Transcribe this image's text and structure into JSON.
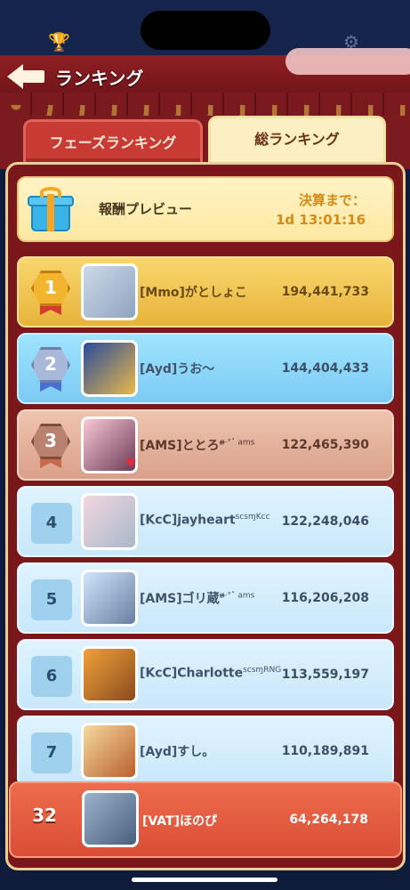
{
  "header": {
    "title": "ランキング"
  },
  "tabs": [
    {
      "label": "フェーズランキング",
      "active": false
    },
    {
      "label": "総ランキング",
      "active": true
    }
  ],
  "reward_preview": {
    "label": "報酬プレビュー",
    "countdown_label": "決算まで：",
    "countdown": "1d 13:01:16"
  },
  "rankings": [
    {
      "rank": "1",
      "name": "[Mmo]がとしょこ",
      "score": "194,441,733",
      "tier": "gold"
    },
    {
      "rank": "2",
      "name": "[Ayd]うお〜",
      "score": "144,404,433",
      "tier": "silver"
    },
    {
      "rank": "3",
      "name": "[AMS]ととろ",
      "name_suffix": "ɞ̴̶̷·°˟ ams",
      "score": "122,465,390",
      "tier": "bronze"
    },
    {
      "rank": "4",
      "name": "[KcC]jayheart",
      "name_suffix": "scsɱKcc",
      "score": "122,248,046",
      "tier": "normal"
    },
    {
      "rank": "5",
      "name": "[AMS]ゴリ蔵",
      "name_suffix": "ɞ̴̶̷·°˟ ams",
      "score": "116,206,208",
      "tier": "normal"
    },
    {
      "rank": "6",
      "name": "[KcC]Charlotte",
      "name_suffix": "scsɱRNG",
      "score": "113,559,197",
      "tier": "normal"
    },
    {
      "rank": "7",
      "name": "[Ayd]すし。",
      "score": "110,189,891",
      "tier": "normal"
    }
  ],
  "my_rank": {
    "rank": "32",
    "name": "[VAT]ほのぴ",
    "score": "64,264,178"
  },
  "colors": {
    "gold_row": "#e7b43a",
    "silver_row": "#7ccaf3",
    "bronze_row": "#d9a08a",
    "normal_row": "#c9e8fa",
    "my_row": "#d94e35",
    "panel": "#7a171b"
  },
  "icons": {
    "top_left": "trophy-icon",
    "top_right": "gear-icon",
    "back": "back-arrow-icon",
    "preview": "gift-box-icon"
  }
}
